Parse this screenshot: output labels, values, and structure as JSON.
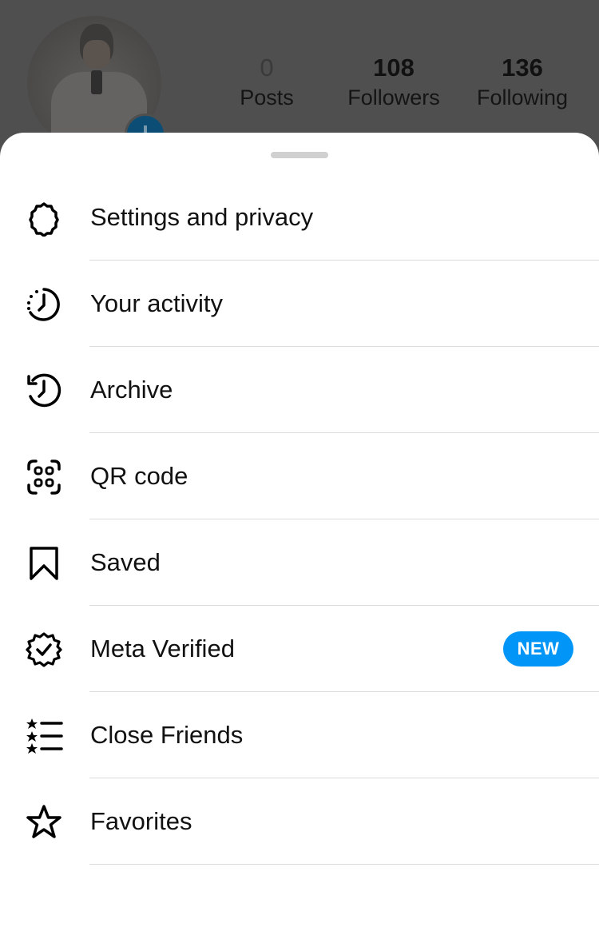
{
  "profile": {
    "avatar_alt": "profile-photo",
    "stats": [
      {
        "value": "0",
        "label": "Posts"
      },
      {
        "value": "108",
        "label": "Followers"
      },
      {
        "value": "136",
        "label": "Following"
      }
    ]
  },
  "sheet": {
    "items": [
      {
        "label": "Settings and privacy",
        "icon": "settings-gear-icon"
      },
      {
        "label": "Your activity",
        "icon": "activity-clock-icon"
      },
      {
        "label": "Archive",
        "icon": "archive-history-icon"
      },
      {
        "label": "QR code",
        "icon": "qr-code-icon"
      },
      {
        "label": "Saved",
        "icon": "bookmark-icon"
      },
      {
        "label": "Meta Verified",
        "icon": "verified-badge-icon",
        "badge": "NEW"
      },
      {
        "label": "Close Friends",
        "icon": "close-friends-list-icon"
      },
      {
        "label": "Favorites",
        "icon": "star-icon"
      }
    ]
  },
  "colors": {
    "accent": "#0095f6",
    "overlay": "#4d4d4d",
    "divider": "#dbdbdb"
  }
}
